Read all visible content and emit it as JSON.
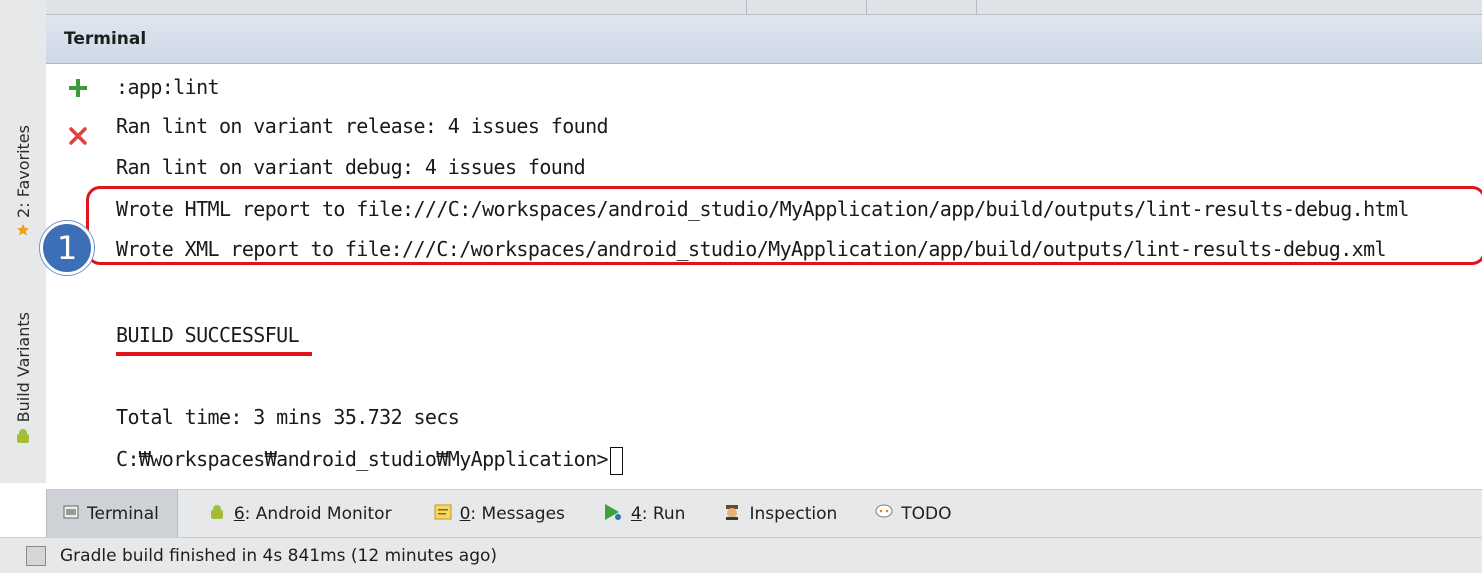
{
  "window": {
    "panel_title": "Terminal"
  },
  "side_tabs": {
    "favorites": "2: Favorites",
    "build_variants": "Build Variants"
  },
  "console": {
    "lines": [
      ":app:lint",
      "Ran lint on variant release: 4 issues found",
      "Ran lint on variant debug: 4 issues found",
      "Wrote HTML report to file:///C:/workspaces/android_studio/MyApplication/app/build/outputs/lint-results-debug.html",
      "Wrote XML report to file:///C:/workspaces/android_studio/MyApplication/app/build/outputs/lint-results-debug.xml",
      "",
      "BUILD SUCCESSFUL",
      "",
      "Total time: 3 mins 35.732 secs",
      "C:₩workspaces₩android_studio₩MyApplication>"
    ]
  },
  "annotation": {
    "badge": "1",
    "color": "#e0141b"
  },
  "tool_windows": [
    {
      "label": "Terminal",
      "icon": "terminal-icon",
      "active": true
    },
    {
      "prefix": "6",
      "label": ": Android Monitor",
      "icon": "android-icon",
      "active": false
    },
    {
      "prefix": "0",
      "label": ": Messages",
      "icon": "messages-icon",
      "active": false
    },
    {
      "prefix": "4",
      "label": ": Run",
      "icon": "run-icon",
      "active": false
    },
    {
      "label": "Inspection",
      "icon": "inspection-icon",
      "active": false
    },
    {
      "label": "TODO",
      "icon": "todo-icon",
      "active": false
    }
  ],
  "status": {
    "message": "Gradle build finished in 4s 841ms (12 minutes ago)"
  },
  "colors": {
    "header_bg": "#d6dde9",
    "accent_red": "#e0141b",
    "plus_green": "#3c9a3c",
    "badge_blue": "#3d6fb6"
  }
}
